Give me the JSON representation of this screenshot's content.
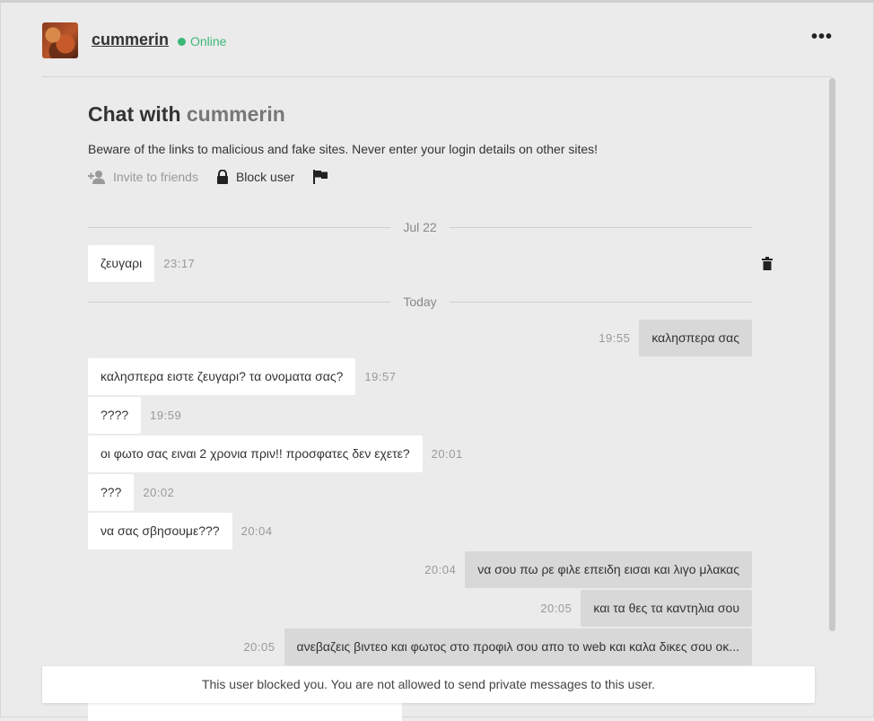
{
  "header": {
    "username": "cummerin",
    "status": "Online",
    "menu_icon": "more-horizontal-icon"
  },
  "chat": {
    "title_prefix": "Chat with ",
    "title_name": "cummerin",
    "warning": "Beware of the links to malicious and fake sites. Never enter your login details on other sites!",
    "actions": {
      "invite_label": "Invite to friends",
      "block_label": "Block user",
      "report_icon": "flag-icon"
    },
    "separators": [
      "Jul 22",
      "Today"
    ],
    "messages": [
      {
        "side": "in",
        "text": "ζευγαρι",
        "time": "23:17"
      },
      {
        "side": "out",
        "text": "καλησπερα σας",
        "time": "19:55"
      },
      {
        "side": "in",
        "text": "καλησπερα ειστε ζευγαρι? τα ονοματα σας?",
        "time": "19:57"
      },
      {
        "side": "in",
        "text": "????",
        "time": "19:59"
      },
      {
        "side": "in",
        "text": "οι φωτο σας ειναι 2 χρονια πριν!! προσφατες δεν εχετε?",
        "time": "20:01"
      },
      {
        "side": "in",
        "text": "???",
        "time": "20:02"
      },
      {
        "side": "in",
        "text": "να σας σβησουμε???",
        "time": "20:04"
      },
      {
        "side": "out",
        "text": "να σου πω ρε φιλε επειδη εισαι και λιγο μλακας",
        "time": "20:04"
      },
      {
        "side": "out",
        "text": "και τα θες τα καντηλια σου",
        "time": "20:05"
      },
      {
        "side": "out",
        "text": "ανεβαζεις βιντεο και φωτος στο προφιλ σου απο το web και καλα δικες σου οκ...",
        "time": "20:05"
      }
    ]
  },
  "notice": "This user blocked you. You are not allowed to send private messages to this user."
}
